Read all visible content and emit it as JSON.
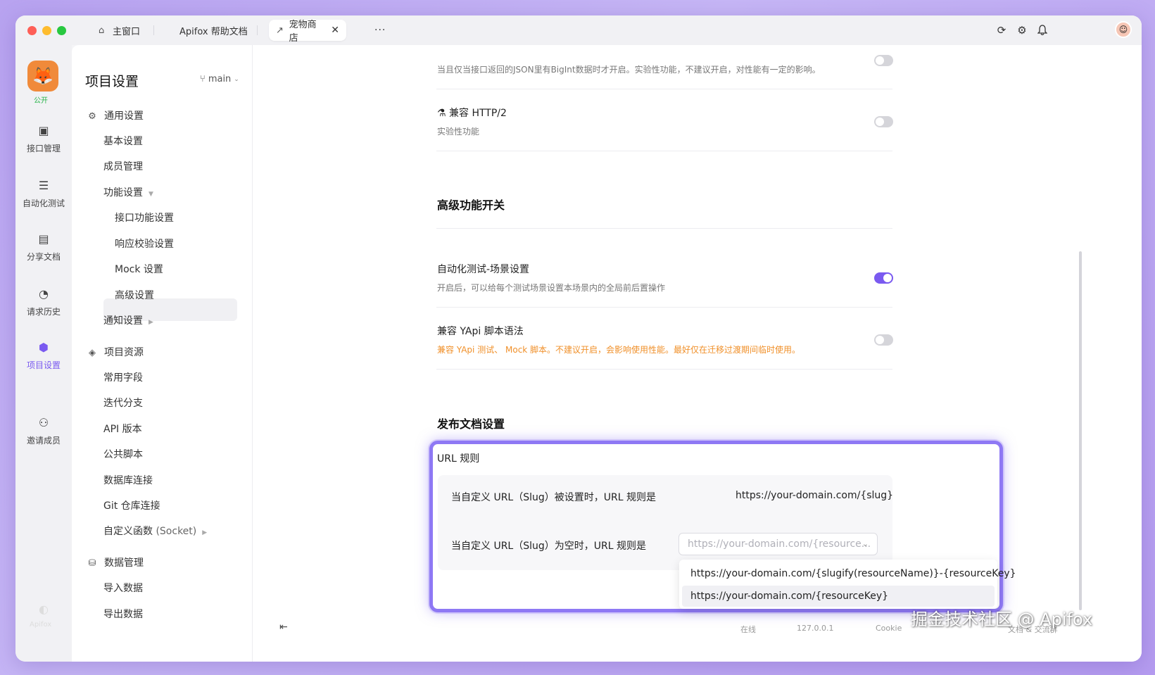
{
  "titlebar": {
    "tabs": [
      {
        "label": "主窗口",
        "icon": "home-icon"
      },
      {
        "label": "Apifox 帮助文档",
        "icon": ""
      },
      {
        "label": "宠物商店",
        "icon": "link-icon",
        "active": true
      }
    ],
    "more": "···"
  },
  "rail": {
    "badge": "公开",
    "items": [
      {
        "label": "接口管理",
        "icon": "api-icon"
      },
      {
        "label": "自动化测试",
        "icon": "automation-icon"
      },
      {
        "label": "分享文档",
        "icon": "book-icon"
      },
      {
        "label": "请求历史",
        "icon": "history-icon"
      },
      {
        "label": "项目设置",
        "icon": "settings-hex-icon",
        "active": true
      },
      {
        "label": "邀请成员",
        "icon": "add-user-icon"
      }
    ],
    "bottom_brand": "Apifox"
  },
  "nav": {
    "title": "项目设置",
    "branch": "main",
    "general": "通用设置",
    "basic": "基本设置",
    "members": "成员管理",
    "features": "功能设置",
    "api_features": "接口功能设置",
    "response_validation": "响应校验设置",
    "mock": "Mock 设置",
    "advanced": "高级设置",
    "notifications": "通知设置",
    "resources": "项目资源",
    "common_fields": "常用字段",
    "iteration": "迭代分支",
    "api_version": "API 版本",
    "public_scripts": "公共脚本",
    "db_conn": "数据库连接",
    "git_conn": "Git 仓库连接",
    "custom_func": "自定义函数",
    "custom_func_suffix": "(Socket)",
    "data_mgmt": "数据管理",
    "import": "导入数据",
    "export": "导出数据"
  },
  "main": {
    "bigint_desc": "当且仅当接口返回的JSON里有BigInt数据时才开启。实验性功能，不建议开启，对性能有一定的影响。",
    "http2_title": "兼容 HTTP/2",
    "http2_desc": "实验性功能",
    "http2_enabled": false,
    "advanced_section": "高级功能开关",
    "scene_title": "自动化测试-场景设置",
    "scene_desc": "开启后，可以给每个测试场景设置本场景内的全局前后置操作",
    "scene_enabled": true,
    "yapi_title": "兼容 YApi 脚本语法",
    "yapi_desc": "兼容 YApi 测试、 Mock 脚本。不建议开启，会影响使用性能。最好仅在迁移过渡期间临时使用。",
    "yapi_enabled": false,
    "publish_section": "发布文档设置",
    "url_rules_label": "URL 规则",
    "slug_set_label": "当自定义 URL（Slug）被设置时，URL 规则是",
    "slug_set_value": "https://your-domain.com/{slug}",
    "slug_empty_label": "当自定义 URL（Slug）为空时，URL 规则是",
    "select_value": "https://your-domain.com/{resource...",
    "options": [
      "https://your-domain.com/{slugify(resourceName)}-{resourceKey}",
      "https://your-domain.com/{resourceKey}"
    ]
  },
  "footer": {
    "online": "在线",
    "ip": "127.0.0.1",
    "cookie": "Cookie",
    "community": "文档 & 交流群"
  },
  "watermark": "掘金技术社区 @ Apifox",
  "colors": {
    "accent": "#7a5af0",
    "highlight": "#8e78f4",
    "warning": "#f0902a"
  }
}
